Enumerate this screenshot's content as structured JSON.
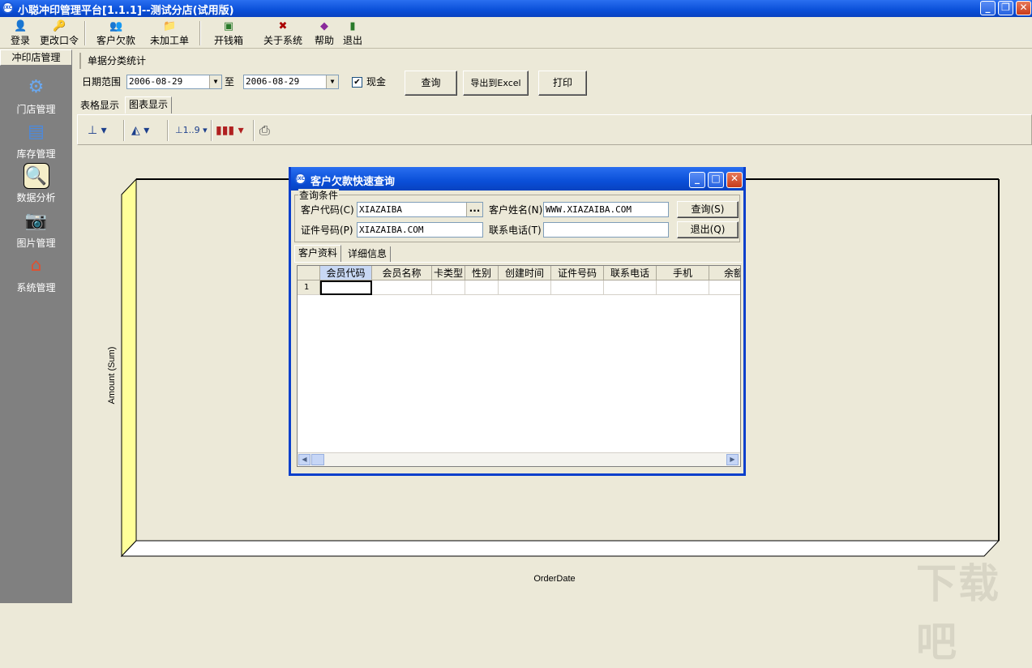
{
  "window": {
    "title": "小聪冲印管理平台[1.1.1]--测试分店(试用版)",
    "app_icon": "JXC"
  },
  "toolbar": {
    "login": "登录",
    "change_password": "更改口令",
    "customer_debt": "客户欠款",
    "unfinished_orders": "未加工单",
    "cash_box": "开钱箱",
    "about": "关于系统",
    "help": "帮助",
    "exit": "退出"
  },
  "nav": {
    "header": "冲印店管理",
    "items": [
      {
        "label": "门店管理",
        "icon": "gear-icon"
      },
      {
        "label": "库存管理",
        "icon": "inventory-icon"
      },
      {
        "label": "数据分析",
        "icon": "magnifier-icon"
      },
      {
        "label": "图片管理",
        "icon": "camera-icon"
      },
      {
        "label": "系统管理",
        "icon": "house-icon"
      }
    ]
  },
  "report": {
    "title": "单据分类统计",
    "date_range_label": "日期范围",
    "date_from": "2006-08-29",
    "to_label": "至",
    "date_to": "2006-08-29",
    "cash_label": "现金",
    "cash_checked": true,
    "query_button": "查询",
    "export_button": "导出到Excel",
    "print_button": "打印",
    "tabs": [
      "表格显示",
      "图表显示"
    ],
    "active_tab": 1
  },
  "chart_data": {
    "type": "bar",
    "xlabel": "OrderDate",
    "ylabel": "Amount (Sum)",
    "categories": [],
    "values": []
  },
  "dialog": {
    "title": "客户欠款快速查询",
    "group_label": "查询条件",
    "customer_code_label": "客户代码(C)",
    "customer_code_value": "XIAZAIBA",
    "customer_name_label": "客户姓名(N)",
    "customer_name_value": "WWW.XIAZAIBA.COM",
    "id_number_label": "证件号码(P)",
    "id_number_value": "XIAZAIBA.COM",
    "phone_label": "联系电话(T)",
    "phone_value": "",
    "query_button": "查询(S)",
    "exit_button": "退出(Q)",
    "ellipsis": "...",
    "tabs": [
      "客户资料",
      "详细信息"
    ],
    "columns": [
      "会员代码",
      "会员名称",
      "卡类型",
      "性别",
      "创建时间",
      "证件号码",
      "联系电话",
      "手机",
      "余额"
    ],
    "row_number": "1"
  },
  "watermark": "下载吧"
}
